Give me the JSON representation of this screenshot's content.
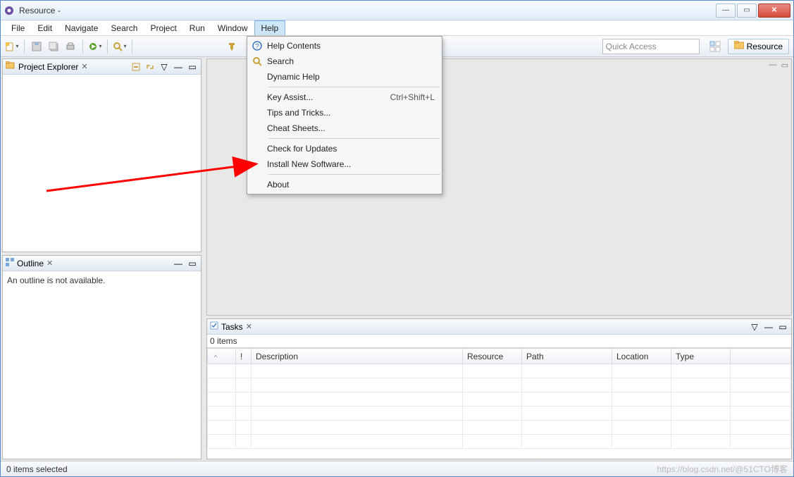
{
  "window": {
    "title": "Resource -"
  },
  "menubar": [
    "File",
    "Edit",
    "Navigate",
    "Search",
    "Project",
    "Run",
    "Window",
    "Help"
  ],
  "toolbar": {
    "quick_access_placeholder": "Quick Access",
    "resource_btn": "Resource"
  },
  "help_menu": {
    "groups": [
      [
        {
          "label": "Help Contents",
          "icon": "help-circle-icon"
        },
        {
          "label": "Search",
          "icon": "search-icon"
        },
        {
          "label": "Dynamic Help",
          "icon": ""
        }
      ],
      [
        {
          "label": "Key Assist...",
          "accel": "Ctrl+Shift+L"
        },
        {
          "label": "Tips and Tricks..."
        },
        {
          "label": "Cheat Sheets..."
        }
      ],
      [
        {
          "label": "Check for Updates"
        },
        {
          "label": "Install New Software..."
        }
      ],
      [
        {
          "label": "About"
        }
      ]
    ]
  },
  "project_explorer": {
    "title": "Project Explorer"
  },
  "outline": {
    "title": "Outline",
    "empty_text": "An outline is not available."
  },
  "tasks": {
    "title": "Tasks",
    "count_text": "0 items",
    "columns": [
      "",
      "!",
      "Description",
      "Resource",
      "Path",
      "Location",
      "Type"
    ]
  },
  "status": {
    "left": "0 items selected",
    "watermark": "https://blog.csdn.net/@51CTO博客"
  }
}
